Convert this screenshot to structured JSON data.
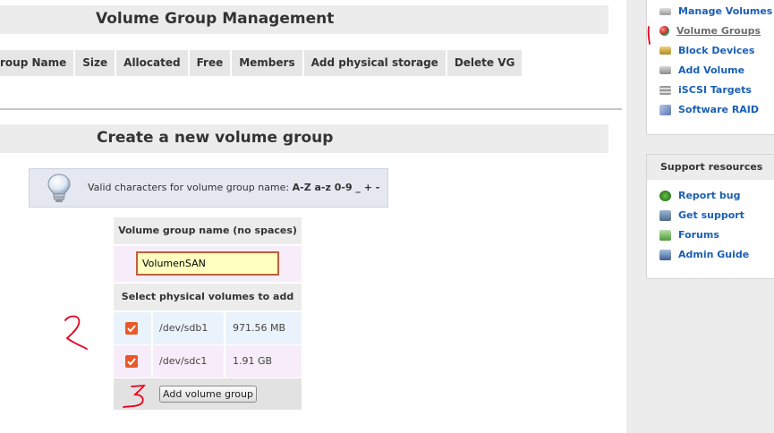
{
  "main": {
    "vg_management_title": "Volume Group Management",
    "vg_table_columns": [
      "roup Name",
      "Size",
      "Allocated",
      "Free",
      "Members",
      "Add physical storage",
      "Delete VG"
    ],
    "create_title": "Create a new volume group",
    "info": {
      "text": "Valid characters for volume group name:",
      "chars": "A-Z a-z 0-9 _ + -"
    },
    "form": {
      "name_label": "Volume group name (no spaces)",
      "name_value": "VolumenSAN",
      "pv_label": "Select physical volumes to add",
      "physical_volumes": [
        {
          "device": "/dev/sdb1",
          "size": "971.56 MB",
          "checked": true
        },
        {
          "device": "/dev/sdc1",
          "size": "1.91 GB",
          "checked": true
        }
      ],
      "submit_label": "Add volume group"
    }
  },
  "sidebar": {
    "nav_items": [
      {
        "label": "Manage Volumes",
        "icon": "disk-icon"
      },
      {
        "label": "Volume Groups",
        "icon": "volume-group-icon",
        "active": true
      },
      {
        "label": "Block Devices",
        "icon": "block-device-icon"
      },
      {
        "label": "Add Volume",
        "icon": "add-volume-icon"
      },
      {
        "label": "iSCSI Targets",
        "icon": "iscsi-icon"
      },
      {
        "label": "Software RAID",
        "icon": "raid-icon"
      }
    ],
    "support": {
      "title": "Support resources",
      "items": [
        {
          "label": "Report bug",
          "icon": "bug-icon"
        },
        {
          "label": "Get support",
          "icon": "support-icon"
        },
        {
          "label": "Forums",
          "icon": "forums-icon"
        },
        {
          "label": "Admin Guide",
          "icon": "guide-icon"
        }
      ]
    }
  },
  "annotations": [
    "1",
    "2",
    "3"
  ],
  "colors": {
    "link": "#1a5fb4",
    "checkbox": "#e8582a",
    "input_border": "#c0603a",
    "input_bg": "#ffffc0",
    "annotation": "#e8001c"
  }
}
